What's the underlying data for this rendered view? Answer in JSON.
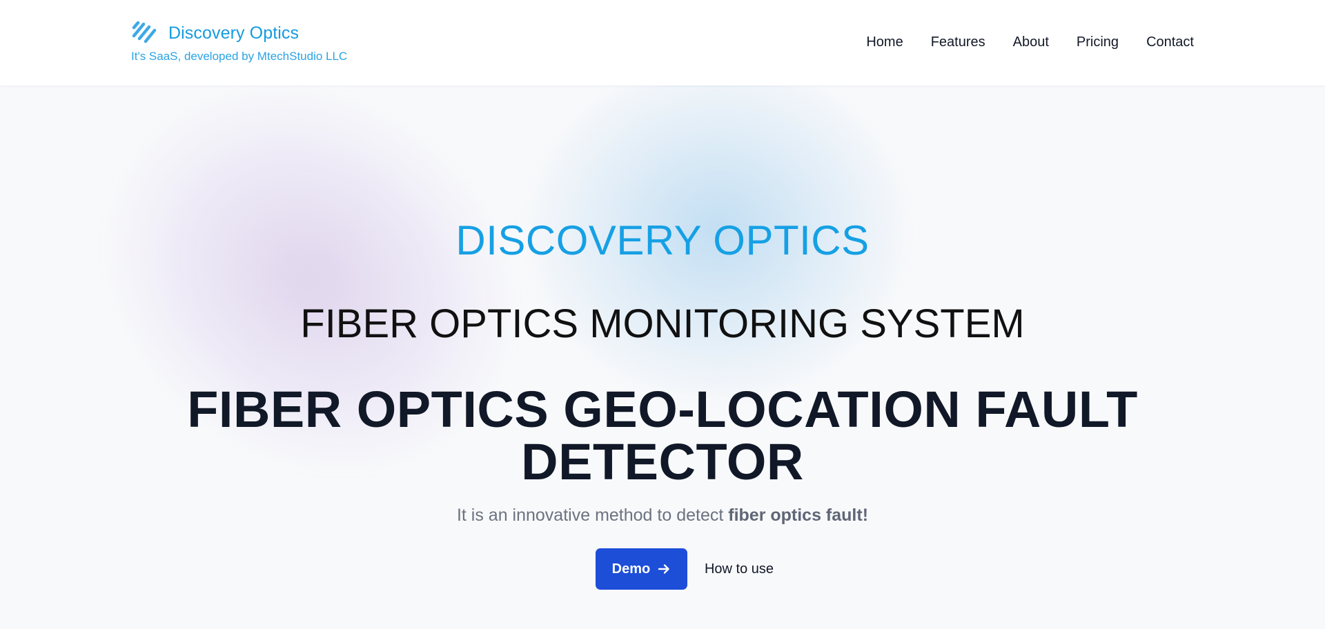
{
  "brand": {
    "name": "Discovery Optics",
    "tagline": "It's SaaS, developed by MtechStudio LLC",
    "logo_icon": "stripes-logo-icon"
  },
  "nav": {
    "items": [
      {
        "label": "Home"
      },
      {
        "label": "Features"
      },
      {
        "label": "About"
      },
      {
        "label": "Pricing"
      },
      {
        "label": "Contact"
      }
    ]
  },
  "hero": {
    "eyebrow": "DISCOVERY OPTICS",
    "subtitle": "FIBER OPTICS MONITORING SYSTEM",
    "headline": "FIBER OPTICS GEO-LOCATION FAULT DETECTOR",
    "description_prefix": "It is an innovative method to detect ",
    "description_bold": "fiber optics fault!",
    "demo_label": "Demo",
    "demo_icon": "arrow-right-icon",
    "howto_label": "How to use"
  },
  "colors": {
    "brand": "#159be0",
    "primary_button": "#1d4ed8",
    "heading": "#111827"
  }
}
